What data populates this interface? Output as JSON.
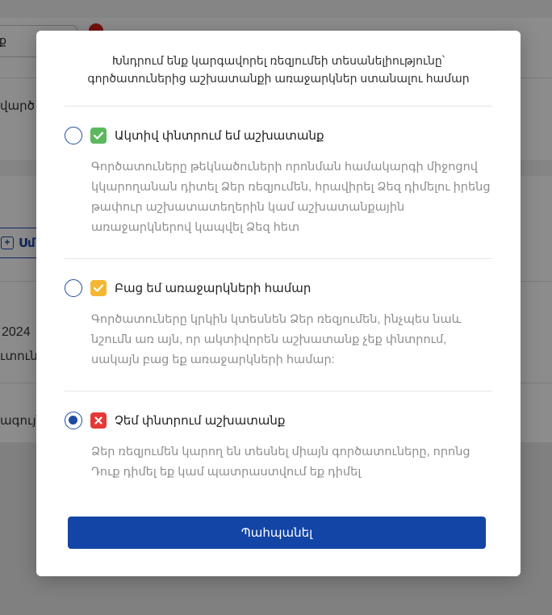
{
  "background": {
    "select_value": "ք",
    "row1_text": "վարծ",
    "button_label": "Սմ",
    "button_icon": "plus-icon",
    "year": "2024",
    "row2_text": "ւտունե",
    "row3_text": "ագույն"
  },
  "modal": {
    "title_line1": "Խնդրում ենք կարգավորել ռեզյումեի տեսանելիությունը՝",
    "title_line2": "գործատուներից աշխատանքի առաջարկներ ստանալու համար",
    "options": [
      {
        "label": "Ակտիվ փնտրում եմ աշխատանք",
        "desc": "Գործատուները թեկնածուների որոնման համակարգի միջոցով կկարողանան դիտել Ձեր ռեզյումեն, հրավիրել Ձեզ դիմելու իրենց թափուր աշխատատեղերին կամ աշխատանքային առաջարկներով կապվել Ձեզ հետ",
        "selected": false,
        "badge_icon": "check-icon",
        "badge_color": "#5cb85c"
      },
      {
        "label": "Բաց եմ առաջարկների համար",
        "desc": "Գործատուները կրկին կտեսնեն Ձեր ռեզյումեն, ինչպես նաև նշումն առ այն, որ ակտիվորեն աշխատանք չեք փնտրում, սակայն բաց եք առաջարկների համար:",
        "selected": false,
        "badge_icon": "check-icon",
        "badge_color": "#f5b731"
      },
      {
        "label": "Չեմ փնտրում աշխատանք",
        "desc": "Ձեր ռեզյումեն կարող են տեսնել միայն գործատուները, որոնց Դուք դիմել եք կամ պատրաստվում եք դիմել",
        "selected": true,
        "badge_icon": "x-icon",
        "badge_color": "#e53935"
      }
    ],
    "save_label": "Պահպանել",
    "save_color": "#1245a6"
  }
}
